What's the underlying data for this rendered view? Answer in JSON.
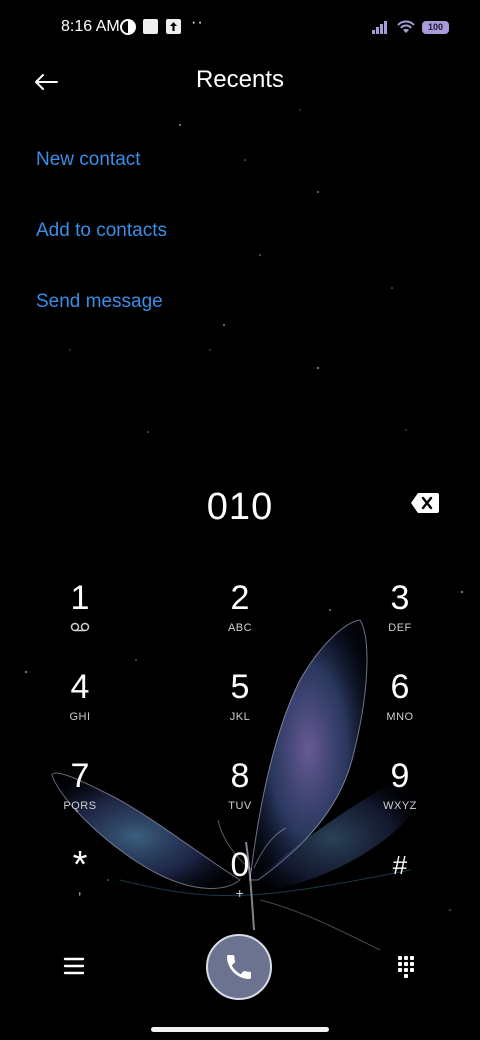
{
  "status_bar": {
    "time": "8:16 AM",
    "battery": "100",
    "icons": [
      "data-saver-icon",
      "square-notification-icon",
      "upload-icon",
      "more-dots-icon",
      "signal-icon",
      "wifi-icon",
      "battery-icon"
    ]
  },
  "header": {
    "title": "Recents"
  },
  "actions": {
    "new_contact": "New contact",
    "add_to_contacts": "Add to contacts",
    "send_message": "Send message"
  },
  "dialer": {
    "number": "010",
    "keys": [
      {
        "digit": "1",
        "letters": ""
      },
      {
        "digit": "2",
        "letters": "ABC"
      },
      {
        "digit": "3",
        "letters": "DEF"
      },
      {
        "digit": "4",
        "letters": "GHI"
      },
      {
        "digit": "5",
        "letters": "JKL"
      },
      {
        "digit": "6",
        "letters": "MNO"
      },
      {
        "digit": "7",
        "letters": "PQRS"
      },
      {
        "digit": "8",
        "letters": "TUV"
      },
      {
        "digit": "9",
        "letters": "WXYZ"
      },
      {
        "digit": "*",
        "letters": ","
      },
      {
        "digit": "0",
        "letters": "+"
      },
      {
        "digit": "#",
        "letters": ""
      }
    ]
  },
  "colors": {
    "link": "#3a8ee6",
    "call_button": "#6b7391",
    "background": "#000000"
  }
}
